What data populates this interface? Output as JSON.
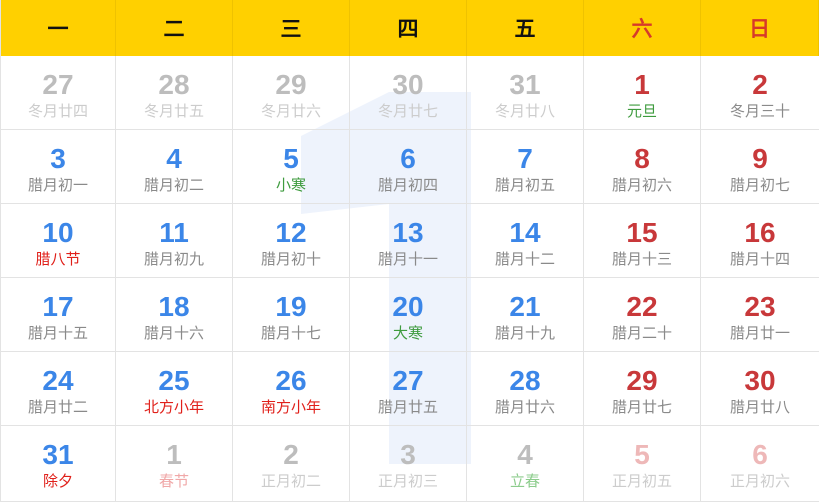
{
  "weekdays": [
    {
      "label": "一",
      "weekend": false
    },
    {
      "label": "二",
      "weekend": false
    },
    {
      "label": "三",
      "weekend": false
    },
    {
      "label": "四",
      "weekend": false
    },
    {
      "label": "五",
      "weekend": false
    },
    {
      "label": "六",
      "weekend": true
    },
    {
      "label": "日",
      "weekend": true
    }
  ],
  "colors": {
    "header_bg": "#ffd000",
    "weekday_blue": "#3b86e8",
    "weekend_red": "#c8383a",
    "lunar_gray": "#8a8a8a",
    "festival_red": "#e0201a",
    "solar_term_green": "#3e9b3e",
    "out_month_num": "#bdbdbd",
    "out_month_lunar": "#cccccc",
    "out_month_weekend": "#eeb8b8",
    "out_month_festival": "#f0a8a8",
    "out_month_term": "#8ccc8c"
  },
  "weeks": [
    [
      {
        "day": "27",
        "sub": "冬月廿四",
        "out": true,
        "weekend": false,
        "kind": "lunar"
      },
      {
        "day": "28",
        "sub": "冬月廿五",
        "out": true,
        "weekend": false,
        "kind": "lunar"
      },
      {
        "day": "29",
        "sub": "冬月廿六",
        "out": true,
        "weekend": false,
        "kind": "lunar"
      },
      {
        "day": "30",
        "sub": "冬月廿七",
        "out": true,
        "weekend": false,
        "kind": "lunar"
      },
      {
        "day": "31",
        "sub": "冬月廿八",
        "out": true,
        "weekend": false,
        "kind": "lunar"
      },
      {
        "day": "1",
        "sub": "元旦",
        "out": false,
        "weekend": true,
        "kind": "term"
      },
      {
        "day": "2",
        "sub": "冬月三十",
        "out": false,
        "weekend": true,
        "kind": "lunar"
      }
    ],
    [
      {
        "day": "3",
        "sub": "腊月初一",
        "out": false,
        "weekend": false,
        "kind": "lunar"
      },
      {
        "day": "4",
        "sub": "腊月初二",
        "out": false,
        "weekend": false,
        "kind": "lunar"
      },
      {
        "day": "5",
        "sub": "小寒",
        "out": false,
        "weekend": false,
        "kind": "term"
      },
      {
        "day": "6",
        "sub": "腊月初四",
        "out": false,
        "weekend": false,
        "kind": "lunar"
      },
      {
        "day": "7",
        "sub": "腊月初五",
        "out": false,
        "weekend": false,
        "kind": "lunar"
      },
      {
        "day": "8",
        "sub": "腊月初六",
        "out": false,
        "weekend": true,
        "kind": "lunar"
      },
      {
        "day": "9",
        "sub": "腊月初七",
        "out": false,
        "weekend": true,
        "kind": "lunar"
      }
    ],
    [
      {
        "day": "10",
        "sub": "腊八节",
        "out": false,
        "weekend": false,
        "kind": "festival"
      },
      {
        "day": "11",
        "sub": "腊月初九",
        "out": false,
        "weekend": false,
        "kind": "lunar"
      },
      {
        "day": "12",
        "sub": "腊月初十",
        "out": false,
        "weekend": false,
        "kind": "lunar"
      },
      {
        "day": "13",
        "sub": "腊月十一",
        "out": false,
        "weekend": false,
        "kind": "lunar"
      },
      {
        "day": "14",
        "sub": "腊月十二",
        "out": false,
        "weekend": false,
        "kind": "lunar"
      },
      {
        "day": "15",
        "sub": "腊月十三",
        "out": false,
        "weekend": true,
        "kind": "lunar"
      },
      {
        "day": "16",
        "sub": "腊月十四",
        "out": false,
        "weekend": true,
        "kind": "lunar"
      }
    ],
    [
      {
        "day": "17",
        "sub": "腊月十五",
        "out": false,
        "weekend": false,
        "kind": "lunar"
      },
      {
        "day": "18",
        "sub": "腊月十六",
        "out": false,
        "weekend": false,
        "kind": "lunar"
      },
      {
        "day": "19",
        "sub": "腊月十七",
        "out": false,
        "weekend": false,
        "kind": "lunar"
      },
      {
        "day": "20",
        "sub": "大寒",
        "out": false,
        "weekend": false,
        "kind": "term"
      },
      {
        "day": "21",
        "sub": "腊月十九",
        "out": false,
        "weekend": false,
        "kind": "lunar"
      },
      {
        "day": "22",
        "sub": "腊月二十",
        "out": false,
        "weekend": true,
        "kind": "lunar"
      },
      {
        "day": "23",
        "sub": "腊月廿一",
        "out": false,
        "weekend": true,
        "kind": "lunar"
      }
    ],
    [
      {
        "day": "24",
        "sub": "腊月廿二",
        "out": false,
        "weekend": false,
        "kind": "lunar"
      },
      {
        "day": "25",
        "sub": "北方小年",
        "out": false,
        "weekend": false,
        "kind": "festival"
      },
      {
        "day": "26",
        "sub": "南方小年",
        "out": false,
        "weekend": false,
        "kind": "festival"
      },
      {
        "day": "27",
        "sub": "腊月廿五",
        "out": false,
        "weekend": false,
        "kind": "lunar"
      },
      {
        "day": "28",
        "sub": "腊月廿六",
        "out": false,
        "weekend": false,
        "kind": "lunar"
      },
      {
        "day": "29",
        "sub": "腊月廿七",
        "out": false,
        "weekend": true,
        "kind": "lunar"
      },
      {
        "day": "30",
        "sub": "腊月廿八",
        "out": false,
        "weekend": true,
        "kind": "lunar"
      }
    ],
    [
      {
        "day": "31",
        "sub": "除夕",
        "out": false,
        "weekend": false,
        "kind": "festival"
      },
      {
        "day": "1",
        "sub": "春节",
        "out": true,
        "weekend": false,
        "kind": "festival"
      },
      {
        "day": "2",
        "sub": "正月初二",
        "out": true,
        "weekend": false,
        "kind": "lunar"
      },
      {
        "day": "3",
        "sub": "正月初三",
        "out": true,
        "weekend": false,
        "kind": "lunar"
      },
      {
        "day": "4",
        "sub": "立春",
        "out": true,
        "weekend": false,
        "kind": "term"
      },
      {
        "day": "5",
        "sub": "正月初五",
        "out": true,
        "weekend": true,
        "kind": "lunar"
      },
      {
        "day": "6",
        "sub": "正月初六",
        "out": true,
        "weekend": true,
        "kind": "lunar"
      }
    ]
  ]
}
